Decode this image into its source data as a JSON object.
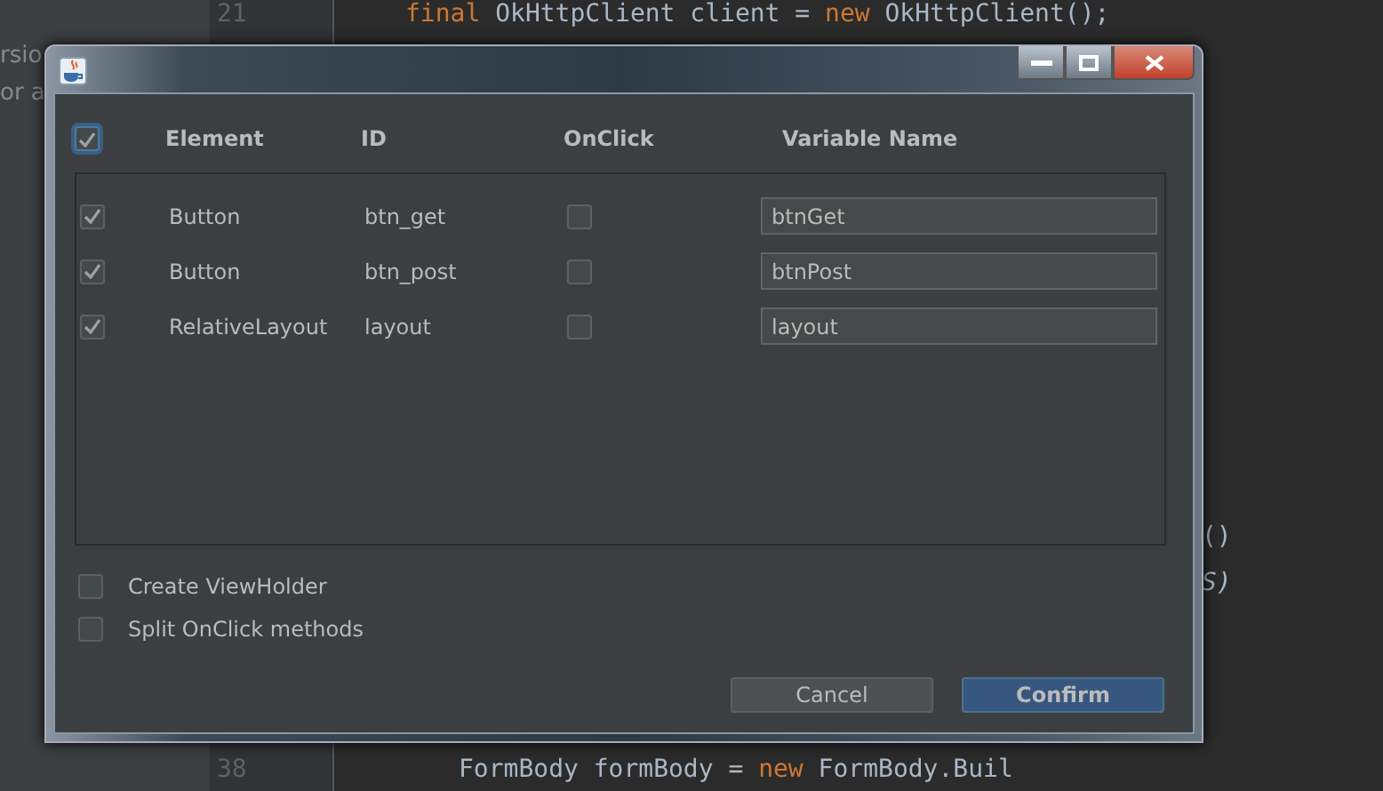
{
  "editor": {
    "side_fragments": [
      "rsio",
      "or a"
    ],
    "top_line": {
      "number": "21",
      "tokens": [
        {
          "kind": "keyword",
          "text": "final"
        },
        {
          "kind": "plain",
          "text": " OkHttpClient client = "
        },
        {
          "kind": "keyword",
          "text": "new"
        },
        {
          "kind": "plain",
          "text": " OkHttpClient();"
        }
      ]
    },
    "right_fragments": [
      {
        "kind": "plain",
        "text": "()"
      },
      {
        "kind": "italic",
        "text": "S)"
      }
    ],
    "bottom_line": {
      "number": "38",
      "tokens": [
        {
          "kind": "plain",
          "text": "FormBody formBody = "
        },
        {
          "kind": "keyword",
          "text": "new"
        },
        {
          "kind": "plain",
          "text": " FormBody.Buil"
        }
      ]
    }
  },
  "dialog": {
    "select_all_checked": true,
    "columns": [
      "Element",
      "ID",
      "OnClick",
      "Variable Name"
    ],
    "rows": [
      {
        "selected": true,
        "element": "Button",
        "id": "btn_get",
        "onclick": false,
        "variable": "btnGet"
      },
      {
        "selected": true,
        "element": "Button",
        "id": "btn_post",
        "onclick": false,
        "variable": "btnPost"
      },
      {
        "selected": true,
        "element": "RelativeLayout",
        "id": "layout",
        "onclick": false,
        "variable": "layout"
      }
    ],
    "options": [
      {
        "label": "Create ViewHolder",
        "checked": false
      },
      {
        "label": "Split OnClick methods",
        "checked": false
      }
    ],
    "buttons": [
      {
        "label": "Cancel",
        "kind": "secondary"
      },
      {
        "label": "Confirm",
        "kind": "primary"
      }
    ]
  }
}
